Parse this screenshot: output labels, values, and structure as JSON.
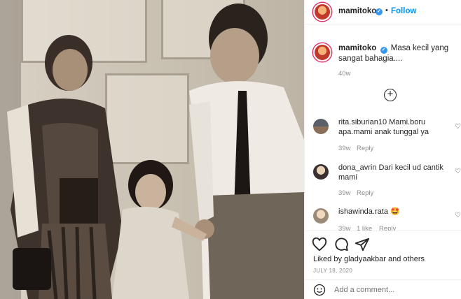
{
  "post": {
    "username": "mamitoko",
    "follow_label": "Follow",
    "separator": "•",
    "caption": "Masa kecil yang sangat bahagia....",
    "caption_age": "40w"
  },
  "comments": [
    {
      "username": "rita.siburian10",
      "text": "Mami.boru apa.mami anak tunggal ya",
      "age": "39w",
      "reply": "Reply"
    },
    {
      "username": "dona_avrin",
      "text": "Dari kecil ud cantik mami",
      "age": "39w",
      "reply": "Reply"
    },
    {
      "username": "ishawinda.rata",
      "text": "🤩",
      "age": "39w",
      "likes": "1 like",
      "reply": "Reply"
    }
  ],
  "actions": {
    "like_icon": "heart-icon",
    "comment_icon": "comment-bubble-icon",
    "share_icon": "paper-plane-icon",
    "liked_by": "Liked by gladyaakbar and others",
    "date": "JULY 18, 2020"
  },
  "comment_box": {
    "placeholder": "Add a comment..."
  },
  "colors": {
    "follow": "#0095f6",
    "verified": "#3897f0",
    "meta": "#8e8e8e"
  }
}
